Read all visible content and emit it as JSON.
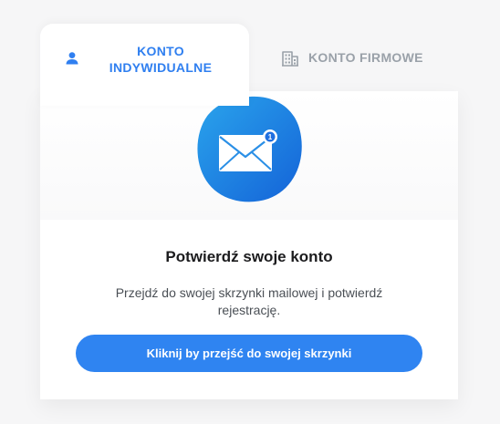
{
  "tabs": {
    "individual": {
      "label_line1": "KONTO",
      "label_line2": "INDYWIDUALNE",
      "icon": "person-icon",
      "active": true
    },
    "company": {
      "label": "KONTO FIRMOWE",
      "icon": "building-icon",
      "active": false
    }
  },
  "mail_illustration": {
    "icon": "envelope-icon",
    "badge_count": "1"
  },
  "confirm": {
    "title": "Potwierdź swoje konto",
    "description": "Przejdź do swojej skrzynki mailowej i potwierdź rejestrację.",
    "button_label": "Kliknij by przejść do swojej skrzynki"
  },
  "colors": {
    "accent": "#2f7ff0",
    "button": "#2f84f1",
    "inactive_tab": "#9aa1a9",
    "background": "#f6f6f7"
  }
}
